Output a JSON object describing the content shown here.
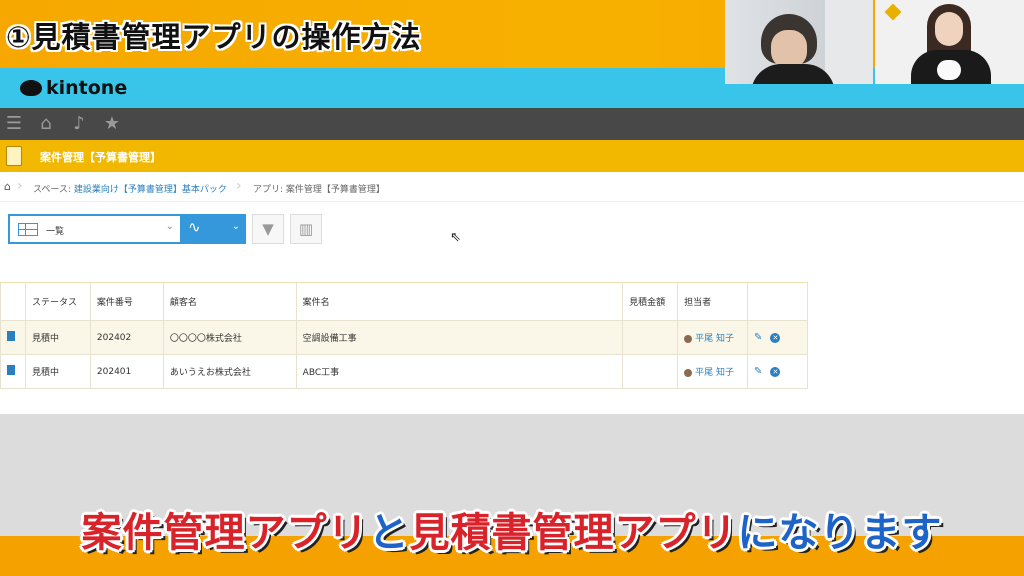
{
  "slide": {
    "title": "①見積書管理アプリの操作方法",
    "caption": {
      "part1": "案件管理アプリ",
      "part2": "と",
      "part3": "見積書管理アプリ",
      "part4": "になります"
    }
  },
  "header": {
    "logo_text": "kintone"
  },
  "nav": {
    "icons": [
      "menu-icon",
      "home-icon",
      "bell-icon",
      "star-icon"
    ]
  },
  "app": {
    "title": "案件管理【予算書管理】"
  },
  "breadcrumb": {
    "space_prefix": "スペース:",
    "space_name": "建設業向け【予算書管理】基本パック",
    "app_label": "アプリ: 案件管理【予算書管理】"
  },
  "toolbar": {
    "view_label": "一覧"
  },
  "table": {
    "columns": [
      "ステータス",
      "案件番号",
      "顧客名",
      "案件名",
      "見積金額",
      "担当者"
    ],
    "rows": [
      {
        "status": "見積中",
        "number": "202402",
        "customer": "〇〇〇〇株式会社",
        "project": "空調設備工事",
        "amount": "",
        "owner": "平尾 知子"
      },
      {
        "status": "見積中",
        "number": "202401",
        "customer": "あいうえお株式会社",
        "project": "ABC工事",
        "amount": "",
        "owner": "平尾 知子"
      }
    ]
  },
  "colors": {
    "accent": "#3498db",
    "app_bar": "#f2b800",
    "kintone_bar": "#39c5ea",
    "caption_red": "#d8232a",
    "caption_blue": "#1e63c8"
  }
}
